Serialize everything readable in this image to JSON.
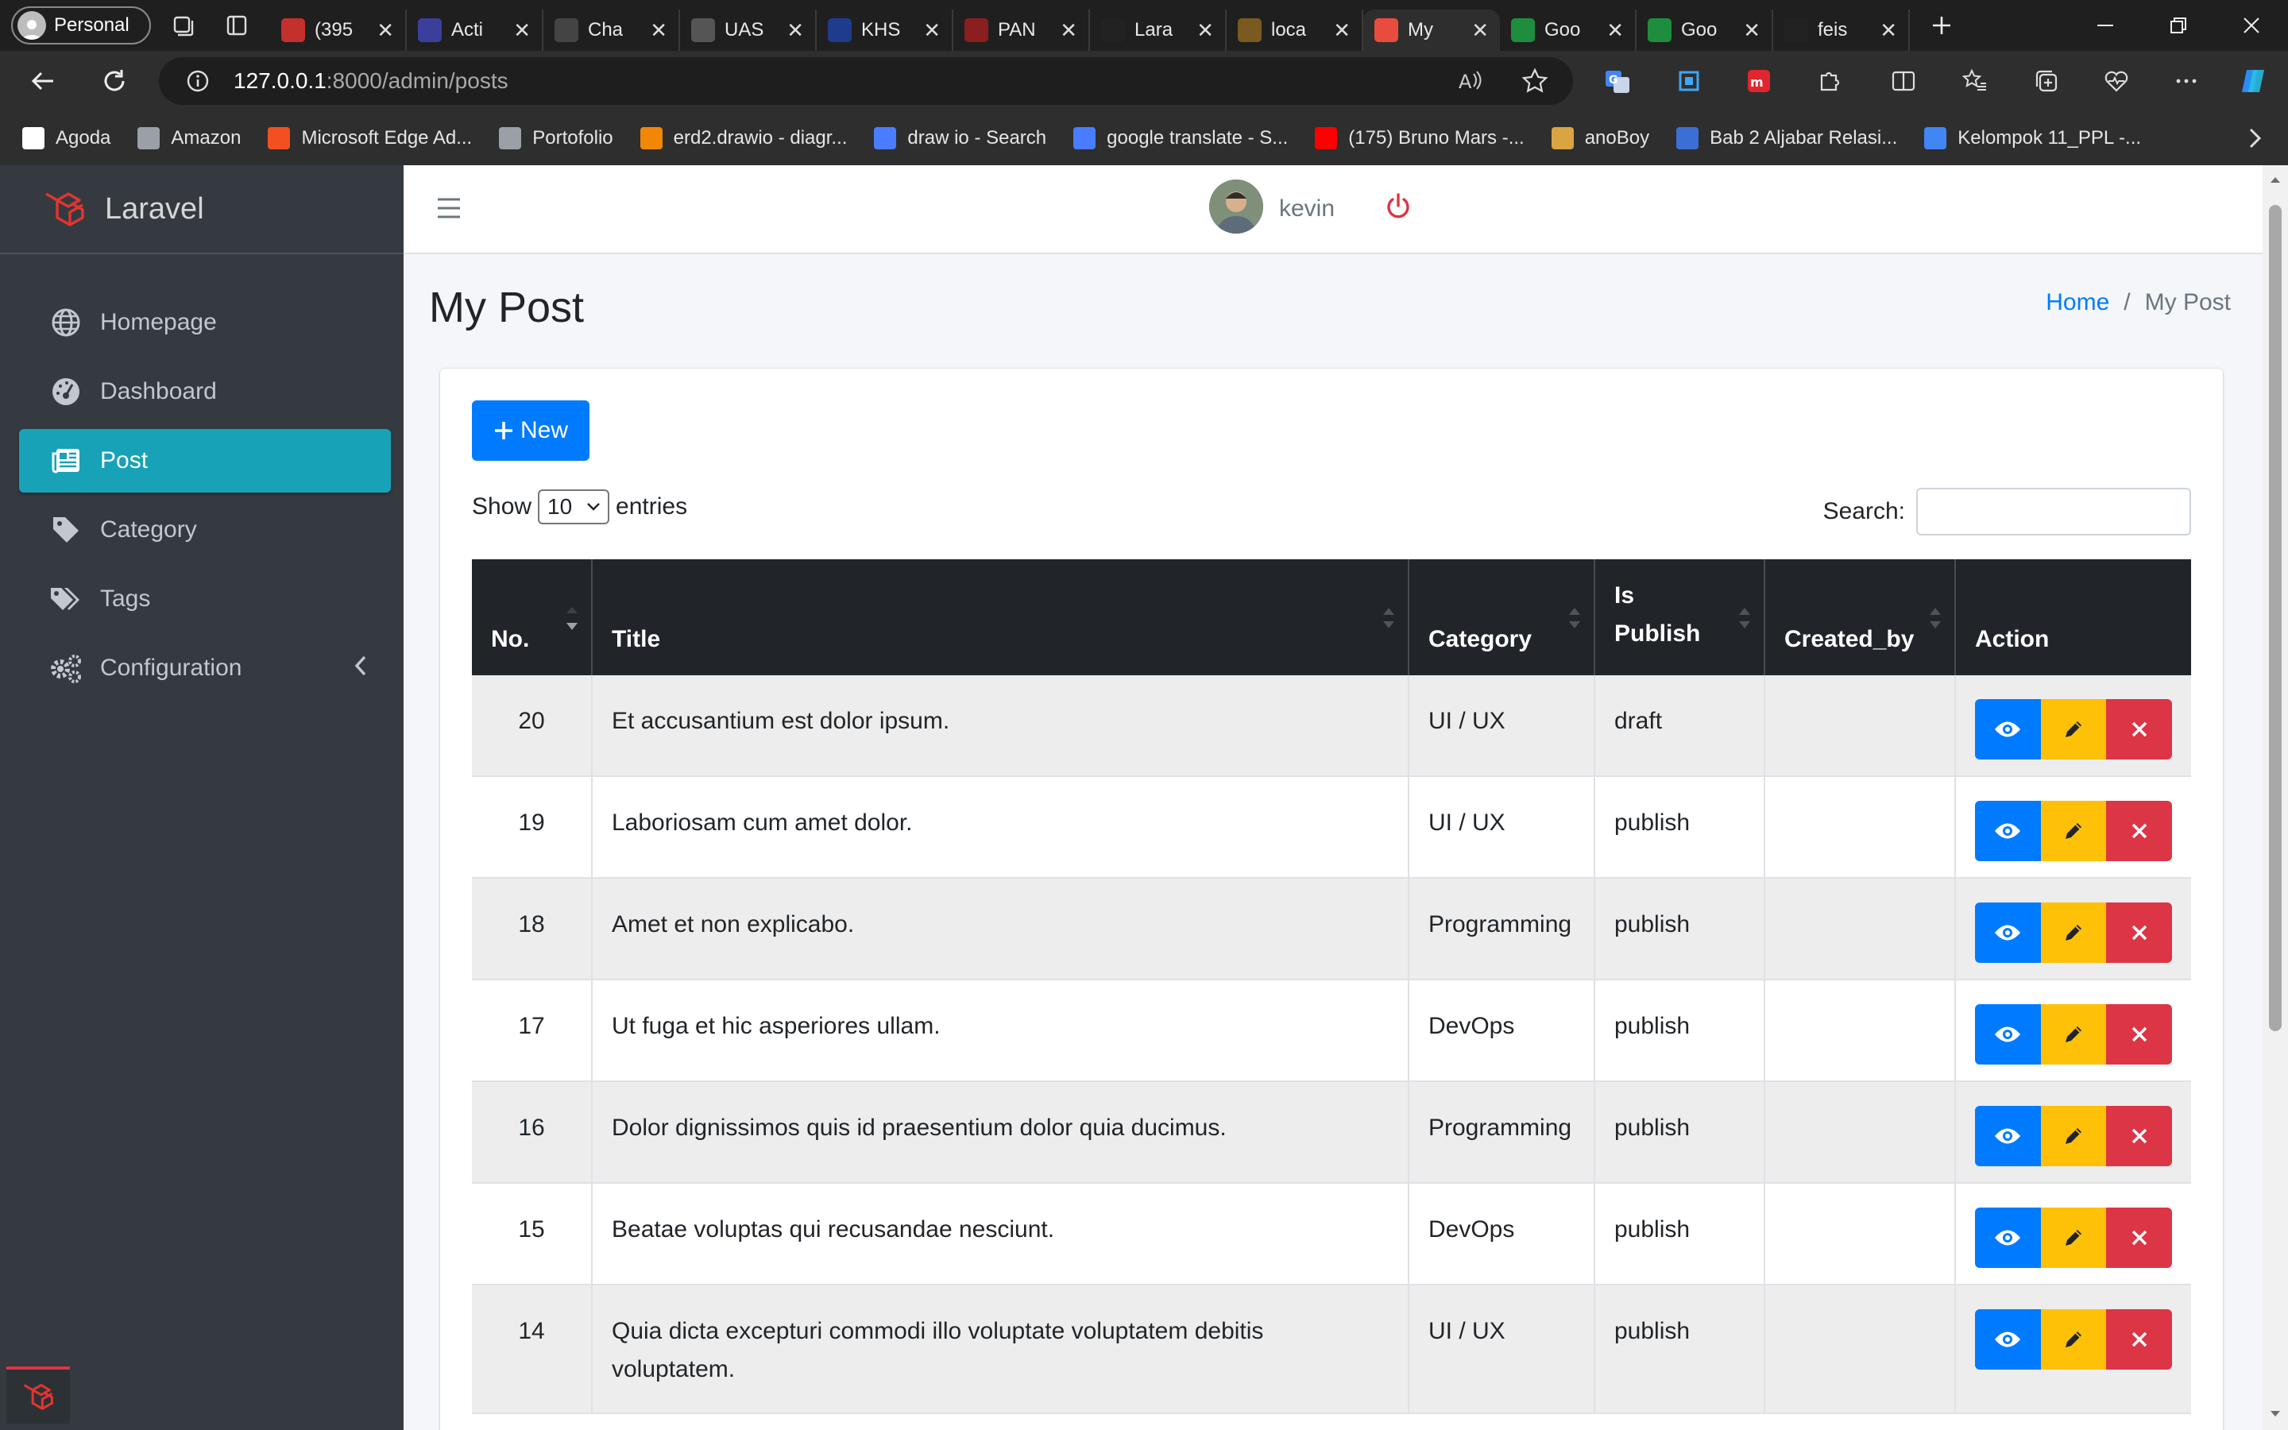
{
  "browser": {
    "profile": "Personal",
    "tabs": [
      {
        "label": "(395",
        "fav_color": "#c4302b",
        "fav_icon": "youtube-icon"
      },
      {
        "label": "Acti",
        "fav_color": "#3b3f9c",
        "fav_icon": "activity-icon"
      },
      {
        "label": "Cha",
        "fav_color": "#444",
        "fav_icon": "openai-icon"
      },
      {
        "label": "UAS",
        "fav_color": "#555",
        "fav_icon": "document-icon"
      },
      {
        "label": "KHS",
        "fav_color": "#1f3b8c",
        "fav_icon": "university-icon"
      },
      {
        "label": "PAN",
        "fav_color": "#8b1e1e",
        "fav_icon": "pdf-icon"
      },
      {
        "label": "Lara",
        "fav_color": "#222",
        "fav_icon": "github-icon"
      },
      {
        "label": "loca",
        "fav_color": "#7a5a1f",
        "fav_icon": "xampp-icon"
      },
      {
        "label": "My",
        "fav_color": "#e74c3c",
        "fav_icon": "laravel-icon",
        "active": true
      },
      {
        "label": "Goo",
        "fav_color": "#1e8e3e",
        "fav_icon": "meet-icon"
      },
      {
        "label": "Goo",
        "fav_color": "#1e8e3e",
        "fav_icon": "meet-icon"
      },
      {
        "label": "feis",
        "fav_color": "#222",
        "fav_icon": "github-icon"
      }
    ],
    "url_host": "127.0.0.1",
    "url_rest": ":8000/admin/posts",
    "bookmarks": [
      {
        "label": "Agoda",
        "color": "#ffffff",
        "icon": "agoda-icon"
      },
      {
        "label": "Amazon",
        "color": "#9aa0a6",
        "icon": "page-icon"
      },
      {
        "label": "Microsoft Edge Ad...",
        "color": "#f25022",
        "icon": "microsoft-icon"
      },
      {
        "label": "Portofolio",
        "color": "#9aa0a6",
        "icon": "page-icon"
      },
      {
        "label": "erd2.drawio - diagr...",
        "color": "#f08705",
        "icon": "drawio-icon"
      },
      {
        "label": "draw io - Search",
        "color": "#4a7cff",
        "icon": "search-icon"
      },
      {
        "label": "google translate - S...",
        "color": "#4a7cff",
        "icon": "search-icon"
      },
      {
        "label": "(175) Bruno Mars -...",
        "color": "#ff0000",
        "icon": "youtube-icon"
      },
      {
        "label": "anoBoy",
        "color": "#d9a441",
        "icon": "anime-icon"
      },
      {
        "label": "Bab 2 Aljabar Relasi...",
        "color": "#3b6fd4",
        "icon": "document-icon"
      },
      {
        "label": "Kelompok 11_PPL -...",
        "color": "#4285f4",
        "icon": "docs-icon"
      }
    ]
  },
  "sidebar": {
    "brand": "Laravel",
    "items": [
      {
        "label": "Homepage",
        "icon": "globe-icon"
      },
      {
        "label": "Dashboard",
        "icon": "gauge-icon"
      },
      {
        "label": "Post",
        "icon": "newspaper-icon",
        "active": true
      },
      {
        "label": "Category",
        "icon": "tag-icon"
      },
      {
        "label": "Tags",
        "icon": "tags-icon"
      },
      {
        "label": "Configuration",
        "icon": "cogs-icon"
      }
    ]
  },
  "topnav": {
    "user": "kevin"
  },
  "page": {
    "title": "My Post",
    "breadcrumb_home": "Home",
    "breadcrumb_sep": "/",
    "breadcrumb_current": "My Post"
  },
  "toolbar": {
    "new_label": "New",
    "show_label": "Show",
    "entries_value": "10",
    "entries_label": "entries",
    "search_label": "Search:",
    "search_value": ""
  },
  "table": {
    "headers": [
      "No.",
      "Title",
      "Category",
      "Is Publish",
      "Created_by",
      "Action"
    ],
    "rows": [
      {
        "no": "20",
        "title": "Et accusantium est dolor ipsum.",
        "category": "UI / UX",
        "status": "draft",
        "created_by": ""
      },
      {
        "no": "19",
        "title": "Laboriosam cum amet dolor.",
        "category": "UI / UX",
        "status": "publish",
        "created_by": ""
      },
      {
        "no": "18",
        "title": "Amet et non explicabo.",
        "category": "Programming",
        "status": "publish",
        "created_by": ""
      },
      {
        "no": "17",
        "title": "Ut fuga et hic asperiores ullam.",
        "category": "DevOps",
        "status": "publish",
        "created_by": ""
      },
      {
        "no": "16",
        "title": "Dolor dignissimos quis id praesentium dolor quia ducimus.",
        "category": "Programming",
        "status": "publish",
        "created_by": ""
      },
      {
        "no": "15",
        "title": "Beatae voluptas qui recusandae nesciunt.",
        "category": "DevOps",
        "status": "publish",
        "created_by": ""
      },
      {
        "no": "14",
        "title": "Quia dicta excepturi commodi illo voluptate voluptatem debitis voluptatem.",
        "category": "UI / UX",
        "status": "publish",
        "created_by": ""
      }
    ]
  },
  "colors": {
    "sidebar_bg": "#343a40",
    "sidebar_active": "#17a2b8",
    "primary": "#007bff",
    "warning": "#ffc107",
    "danger": "#dc3545",
    "table_head": "#212529"
  }
}
